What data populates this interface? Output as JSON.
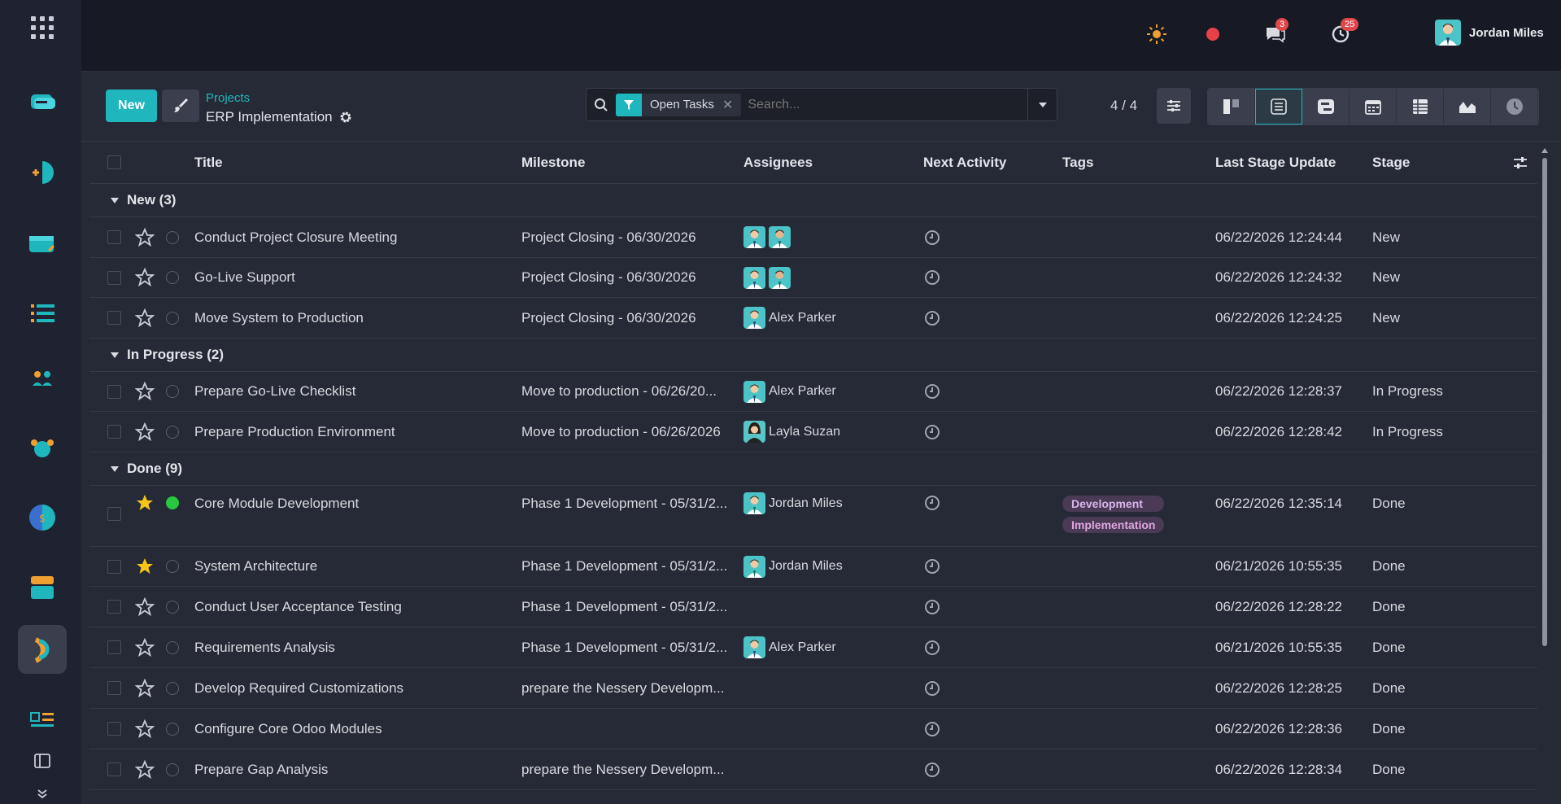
{
  "topbar": {
    "chat_badge": "3",
    "activity_badge": "25",
    "user_name": "Jordan Miles"
  },
  "controls": {
    "new_label": "New",
    "breadcrumb_parent": "Projects",
    "breadcrumb_current": "ERP Implementation",
    "filter_label": "Open Tasks",
    "search_placeholder": "Search...",
    "pager": "4 / 4"
  },
  "columns": {
    "title": "Title",
    "milestone": "Milestone",
    "assignees": "Assignees",
    "next_activity": "Next Activity",
    "tags": "Tags",
    "last_stage_update": "Last Stage Update",
    "stage": "Stage"
  },
  "groups": [
    {
      "label": "New (3)",
      "rows": [
        {
          "title": "Conduct Project Closure Meeting",
          "milestone": "Project Closing - 06/30/2026",
          "assignee": "",
          "date": "06/22/2026 12:24:44",
          "stage": "New"
        },
        {
          "title": "Go-Live Support",
          "milestone": "Project Closing - 06/30/2026",
          "assignee": "",
          "date": "06/22/2026 12:24:32",
          "stage": "New"
        },
        {
          "title": "Move System to Production",
          "milestone": "Project Closing - 06/30/2026",
          "assignee": "Alex Parker",
          "date": "06/22/2026 12:24:25",
          "stage": "New"
        }
      ]
    },
    {
      "label": "In Progress (2)",
      "rows": [
        {
          "title": "Prepare Go-Live Checklist",
          "milestone": "Move to production - 06/26/20...",
          "assignee": "Alex Parker",
          "date": "06/22/2026 12:28:37",
          "stage": "In Progress"
        },
        {
          "title": "Prepare Production Environment",
          "milestone": "Move to production - 06/26/2026",
          "assignee": "Layla Suzan",
          "date": "06/22/2026 12:28:42",
          "stage": "In Progress"
        }
      ]
    },
    {
      "label": "Done (9)",
      "rows": [
        {
          "title": "Core Module Development",
          "milestone": "Phase 1 Development - 05/31/2...",
          "assignee": "Jordan Miles",
          "tag1": "Development",
          "tag2": "Implementation",
          "date": "06/22/2026 12:35:14",
          "stage": "Done"
        },
        {
          "title": "System Architecture",
          "milestone": "Phase 1 Development - 05/31/2...",
          "assignee": "Jordan Miles",
          "date": "06/21/2026 10:55:35",
          "stage": "Done"
        },
        {
          "title": "Conduct User Acceptance Testing",
          "milestone": "Phase 1 Development - 05/31/2...",
          "assignee": "",
          "date": "06/22/2026 12:28:22",
          "stage": "Done"
        },
        {
          "title": "Requirements Analysis",
          "milestone": "Phase 1 Development - 05/31/2...",
          "assignee": "Alex Parker",
          "date": "06/21/2026 10:55:35",
          "stage": "Done"
        },
        {
          "title": "Develop Required Customizations",
          "milestone": "prepare the Nessery Developm...",
          "assignee": "",
          "date": "06/22/2026 12:28:25",
          "stage": "Done"
        },
        {
          "title": "Configure Core Odoo Modules",
          "milestone": "",
          "assignee": "",
          "date": "06/22/2026 12:28:36",
          "stage": "Done"
        },
        {
          "title": "Prepare Gap Analysis",
          "milestone": "prepare the Nessery Developm...",
          "assignee": "",
          "date": "06/22/2026 12:28:34",
          "stage": "Done"
        }
      ]
    }
  ],
  "colors": {
    "accent": "#1fb6bd",
    "star_active": "#f5c518",
    "status_done": "#28c840",
    "badge": "#e0474c"
  }
}
